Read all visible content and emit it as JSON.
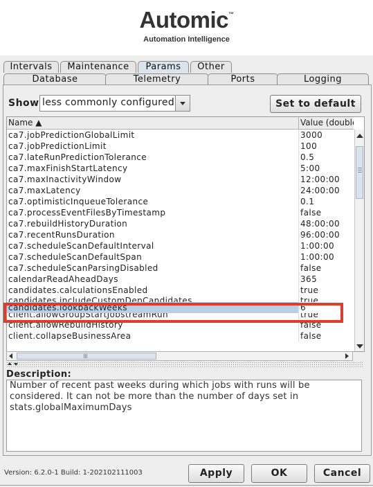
{
  "header": {
    "brand": "Automic",
    "trademark": "™",
    "tagline": "Automation Intelligence"
  },
  "tabs_top": [
    {
      "label": "Intervals",
      "active": false
    },
    {
      "label": "Maintenance",
      "active": false
    },
    {
      "label": "Params",
      "active": true
    },
    {
      "label": "Other",
      "active": false
    }
  ],
  "tabs_bottom": [
    {
      "label": "Database"
    },
    {
      "label": "Telemetry"
    },
    {
      "label": "Ports"
    },
    {
      "label": "Logging"
    }
  ],
  "filter": {
    "show_label": "Show",
    "show_value": "less commonly configured",
    "set_default_label": "Set to default"
  },
  "table": {
    "columns": [
      "Name ▲",
      "Value (double"
    ],
    "rows": [
      {
        "name": "ca7.jobPredictionGlobalLimit",
        "value": "3000"
      },
      {
        "name": "ca7.jobPredictionLimit",
        "value": "100"
      },
      {
        "name": "ca7.lateRunPredictionTolerance",
        "value": "0.5"
      },
      {
        "name": "ca7.maxFinishStartLatency",
        "value": "5:00"
      },
      {
        "name": "ca7.maxInactivityWindow",
        "value": "12:00:00"
      },
      {
        "name": "ca7.maxLatency",
        "value": "24:00:00"
      },
      {
        "name": "ca7.optimisticInqueueTolerance",
        "value": "0.1"
      },
      {
        "name": "ca7.processEventFilesByTimestamp",
        "value": "false"
      },
      {
        "name": "ca7.rebuildHistoryDuration",
        "value": "48:00:00"
      },
      {
        "name": "ca7.recentRunsDuration",
        "value": "96:00:00"
      },
      {
        "name": "ca7.scheduleScanDefaultInterval",
        "value": "1:00:00"
      },
      {
        "name": "ca7.scheduleScanDefaultSpan",
        "value": "1:00:00"
      },
      {
        "name": "ca7.scheduleScanParsingDisabled",
        "value": "false"
      },
      {
        "name": "calendarReadAheadDays",
        "value": "365"
      },
      {
        "name": "candidates.calculationsEnabled",
        "value": "true"
      },
      {
        "name": "candidates.includeCustomDepCandidates",
        "value": "true"
      },
      {
        "name": "candidates.lookbackWeeks",
        "value": "6"
      },
      {
        "name": "client.allowGroupStartJobstreamRun",
        "value": "true"
      },
      {
        "name": "client.allowRebuildHistory",
        "value": "false"
      },
      {
        "name": "client.collapseBusinessArea",
        "value": "false"
      }
    ],
    "selected_row": "candidates.lookbackWeeks"
  },
  "description": {
    "label": "Description:",
    "text": "Number of recent past weeks during which jobs with runs will be considered. It can not be more than the number of days set in stats.globalMaximumDays"
  },
  "footer": {
    "version": "Version: 6.2.0-1    Build: 1-202102111003",
    "apply_label": "Apply",
    "ok_label": "OK",
    "cancel_label": "Cancel"
  },
  "colors": {
    "highlight": "#e23b28",
    "selection": "#b8cfe5",
    "panel": "#eeeeee"
  }
}
